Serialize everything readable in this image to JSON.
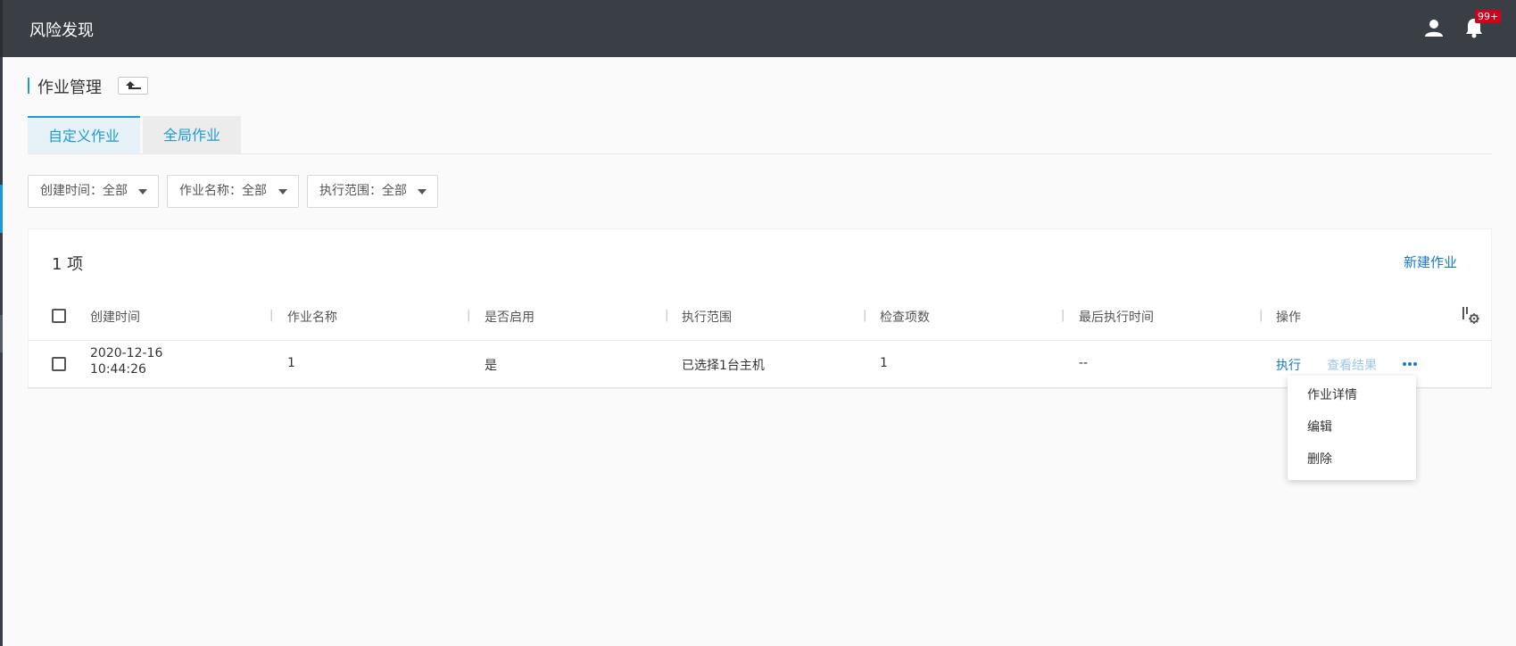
{
  "header": {
    "app_title": "风险发现",
    "notification_count": "99+"
  },
  "page": {
    "title": "作业管理"
  },
  "tabs": [
    {
      "label": "自定义作业",
      "active": true
    },
    {
      "label": "全局作业",
      "active": false
    }
  ],
  "filters": [
    {
      "label": "创建时间：全部"
    },
    {
      "label": "作业名称：全部"
    },
    {
      "label": "执行范围：全部"
    }
  ],
  "table": {
    "count_label": "1 项",
    "new_button": "新建作业",
    "columns": [
      "创建时间",
      "作业名称",
      "是否启用",
      "执行范围",
      "检查项数",
      "最后执行时间",
      "操作"
    ],
    "rows": [
      {
        "created_date": "2020-12-16",
        "created_time": "10:44:26",
        "name": "1",
        "enabled": "是",
        "scope": "已选择1台主机",
        "check_count": "1",
        "last_exec": "--",
        "actions": {
          "execute": "执行",
          "view_results": "查看结果"
        }
      }
    ]
  },
  "more_menu": {
    "items": [
      "作业详情",
      "编辑",
      "删除"
    ]
  },
  "colors": {
    "topbar": "#3a3f46",
    "accent": "#1a9bd7",
    "link": "#1a78c2",
    "badge": "#d0021b"
  }
}
